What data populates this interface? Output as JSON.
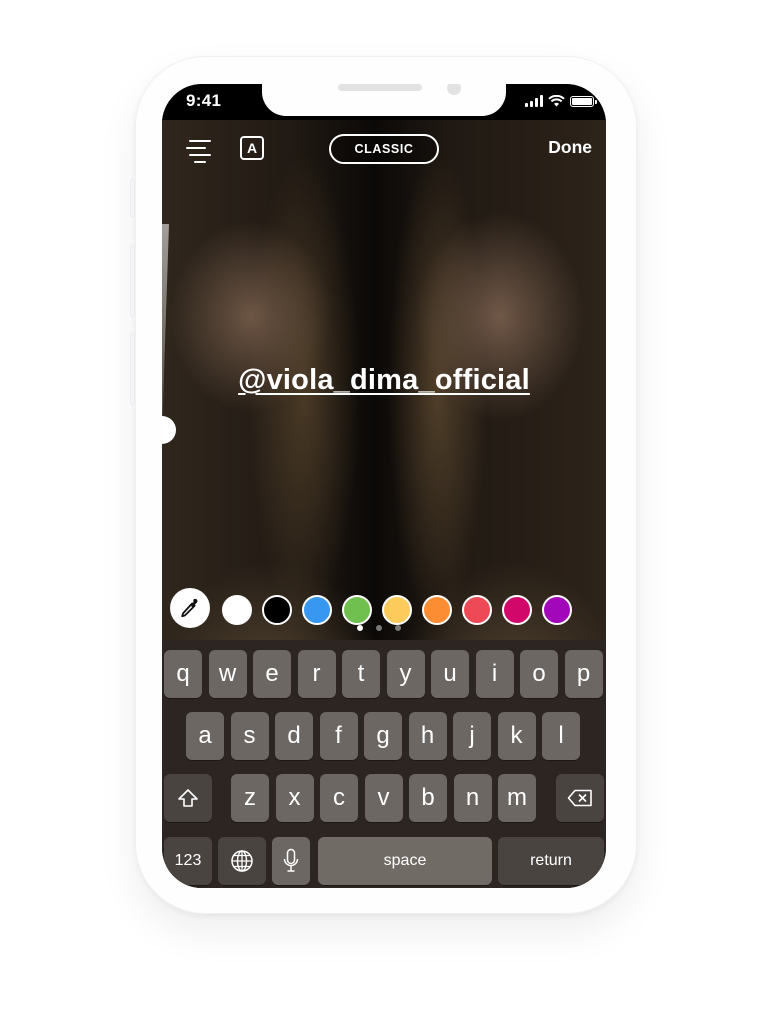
{
  "status_bar": {
    "time": "9:41",
    "signal_icon": "cellular-signal-icon",
    "wifi_icon": "wifi-icon",
    "battery_icon": "battery-icon"
  },
  "toolbar": {
    "align_icon": "text-align-center-icon",
    "font_icon": "text-background-toggle-icon",
    "font_icon_label": "A",
    "style_label": "CLASSIC",
    "done_label": "Done"
  },
  "canvas": {
    "mention_text": "@viola_dima_official",
    "text_size_slider_icon": "text-size-slider"
  },
  "palette": {
    "eyedropper_icon": "eyedropper-icon",
    "colors": [
      "#ffffff",
      "#000000",
      "#3897f0",
      "#70c050",
      "#fdcb5c",
      "#fd8d32",
      "#ed4956",
      "#d10869",
      "#a307ba"
    ],
    "page_count": 3,
    "current_page": 1
  },
  "keyboard": {
    "row1": [
      "q",
      "w",
      "e",
      "r",
      "t",
      "y",
      "u",
      "i",
      "o",
      "p"
    ],
    "row2": [
      "a",
      "s",
      "d",
      "f",
      "g",
      "h",
      "j",
      "k",
      "l"
    ],
    "row3": [
      "z",
      "x",
      "c",
      "v",
      "b",
      "n",
      "m"
    ],
    "shift_icon": "shift-icon",
    "delete_icon": "backspace-icon",
    "numbers_label": "123",
    "globe_icon": "globe-icon",
    "mic_icon": "microphone-icon",
    "space_label": "space",
    "return_label": "return"
  }
}
